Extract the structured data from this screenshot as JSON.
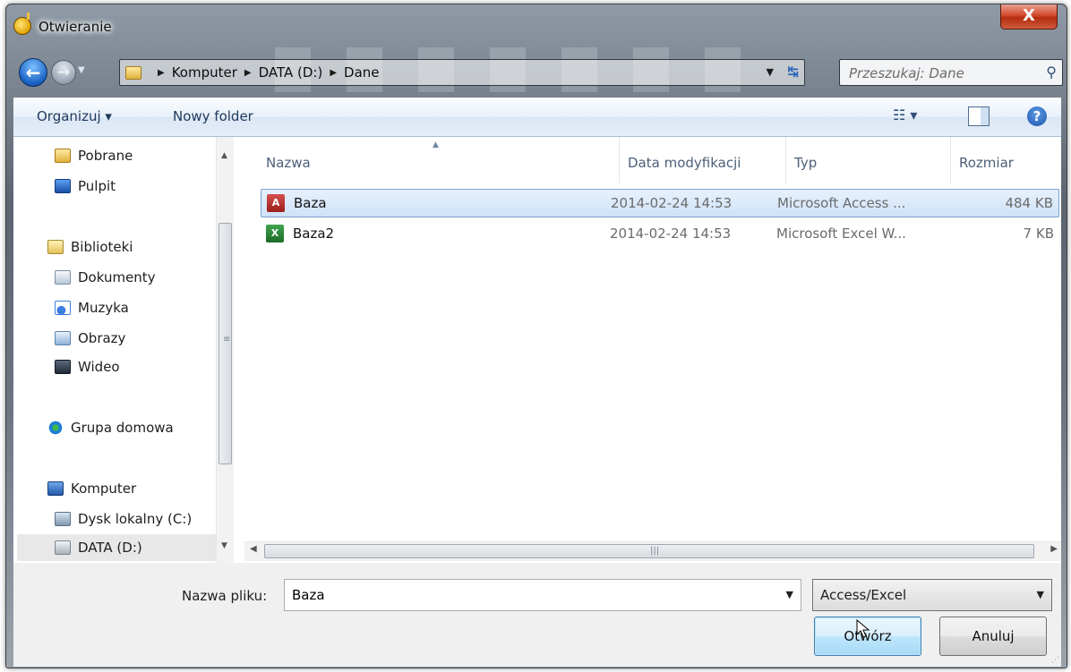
{
  "window": {
    "title": "Otwieranie",
    "close_label": "X"
  },
  "nav_buttons": {
    "back_icon": "back-arrow-icon",
    "forward_icon": "forward-arrow-icon"
  },
  "address": {
    "crumbs": [
      "Komputer",
      "DATA (D:)",
      "Dane"
    ]
  },
  "search": {
    "placeholder": "Przeszukaj: Dane"
  },
  "toolbar": {
    "organize_label": "Organizuj ▾",
    "new_folder_label": "Nowy folder"
  },
  "sidebar": {
    "items": [
      {
        "label": "Pobrane",
        "icon": "downloads-folder-icon"
      },
      {
        "label": "Pulpit",
        "icon": "desktop-icon"
      },
      {
        "label": "Biblioteki",
        "icon": "libraries-icon"
      },
      {
        "label": "Dokumenty",
        "icon": "documents-icon"
      },
      {
        "label": "Muzyka",
        "icon": "music-icon"
      },
      {
        "label": "Obrazy",
        "icon": "pictures-icon"
      },
      {
        "label": "Wideo",
        "icon": "video-icon"
      },
      {
        "label": "Grupa domowa",
        "icon": "homegroup-icon"
      },
      {
        "label": "Komputer",
        "icon": "computer-icon"
      },
      {
        "label": "Dysk lokalny (C:)",
        "icon": "local-disk-icon"
      },
      {
        "label": "DATA (D:)",
        "icon": "drive-icon"
      }
    ]
  },
  "file_list": {
    "columns": [
      "Nazwa",
      "Data modyfikacji",
      "Typ",
      "Rozmiar"
    ],
    "rows": [
      {
        "name": "Baza",
        "date": "2014-02-24 14:53",
        "type": "Microsoft Access ...",
        "size": "484 KB",
        "icon": "access-file-icon",
        "selected": true
      },
      {
        "name": "Baza2",
        "date": "2014-02-24 14:53",
        "type": "Microsoft Excel W...",
        "size": "7 KB",
        "icon": "excel-file-icon",
        "selected": false
      }
    ]
  },
  "bottom": {
    "filename_label": "Nazwa pliku:",
    "filename_value": "Baza",
    "filetype_value": "Access/Excel",
    "open_label": "Otwórz",
    "cancel_label": "Anuluj"
  },
  "colors": {
    "selection_bg": "#cfe2f8",
    "selection_border": "#7da2ce",
    "toolbar_text": "#1e395b",
    "close_button": "#c7442a"
  }
}
